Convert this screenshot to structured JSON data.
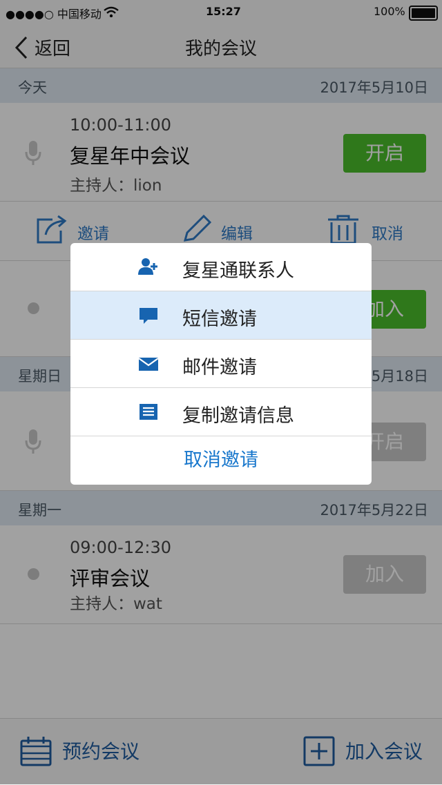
{
  "status_bar": {
    "carrier": "●●●●○ 中国移动",
    "time": "15:27",
    "battery": "100%"
  },
  "nav": {
    "back_label": "返回",
    "title": "我的会议"
  },
  "days": [
    {
      "day_label": "今天",
      "date": "2017年5月10日",
      "meeting": {
        "time": "10:00-11:00",
        "title": "复星年中会议",
        "host": "主持人：lion",
        "button": "开启",
        "button_color": "#4bbf2b",
        "icon": "mic-icon"
      },
      "actions": [
        "邀请",
        "编辑",
        "取消"
      ]
    },
    {
      "meeting_partial": {
        "button": "加入",
        "button_color": "#4bbf2b"
      }
    },
    {
      "day_label": "星期日",
      "date": "2017年5月18日",
      "meeting_partial": {
        "button": "开启",
        "button_color": "#c9c9c9",
        "icon": "mic-icon"
      }
    },
    {
      "day_label": "星期一",
      "date": "2017年5月22日",
      "meeting": {
        "time": "09:00-12:30",
        "title": "评审会议",
        "host": "主持人：wat",
        "button": "加入",
        "button_color": "#c9c9c9"
      }
    }
  ],
  "toolbar": {
    "schedule_label": "预约会议",
    "join_label": "加入会议"
  },
  "invite_sheet": {
    "items": [
      {
        "label": "复星通联系人",
        "icon": "add-contact-icon"
      },
      {
        "label": "短信邀请",
        "icon": "sms-icon",
        "highlighted": true
      },
      {
        "label": "邮件邀请",
        "icon": "mail-icon"
      },
      {
        "label": "复制邀请信息",
        "icon": "copy-info-icon"
      }
    ],
    "cancel_label": "取消邀请",
    "accent": "#1877cc"
  }
}
